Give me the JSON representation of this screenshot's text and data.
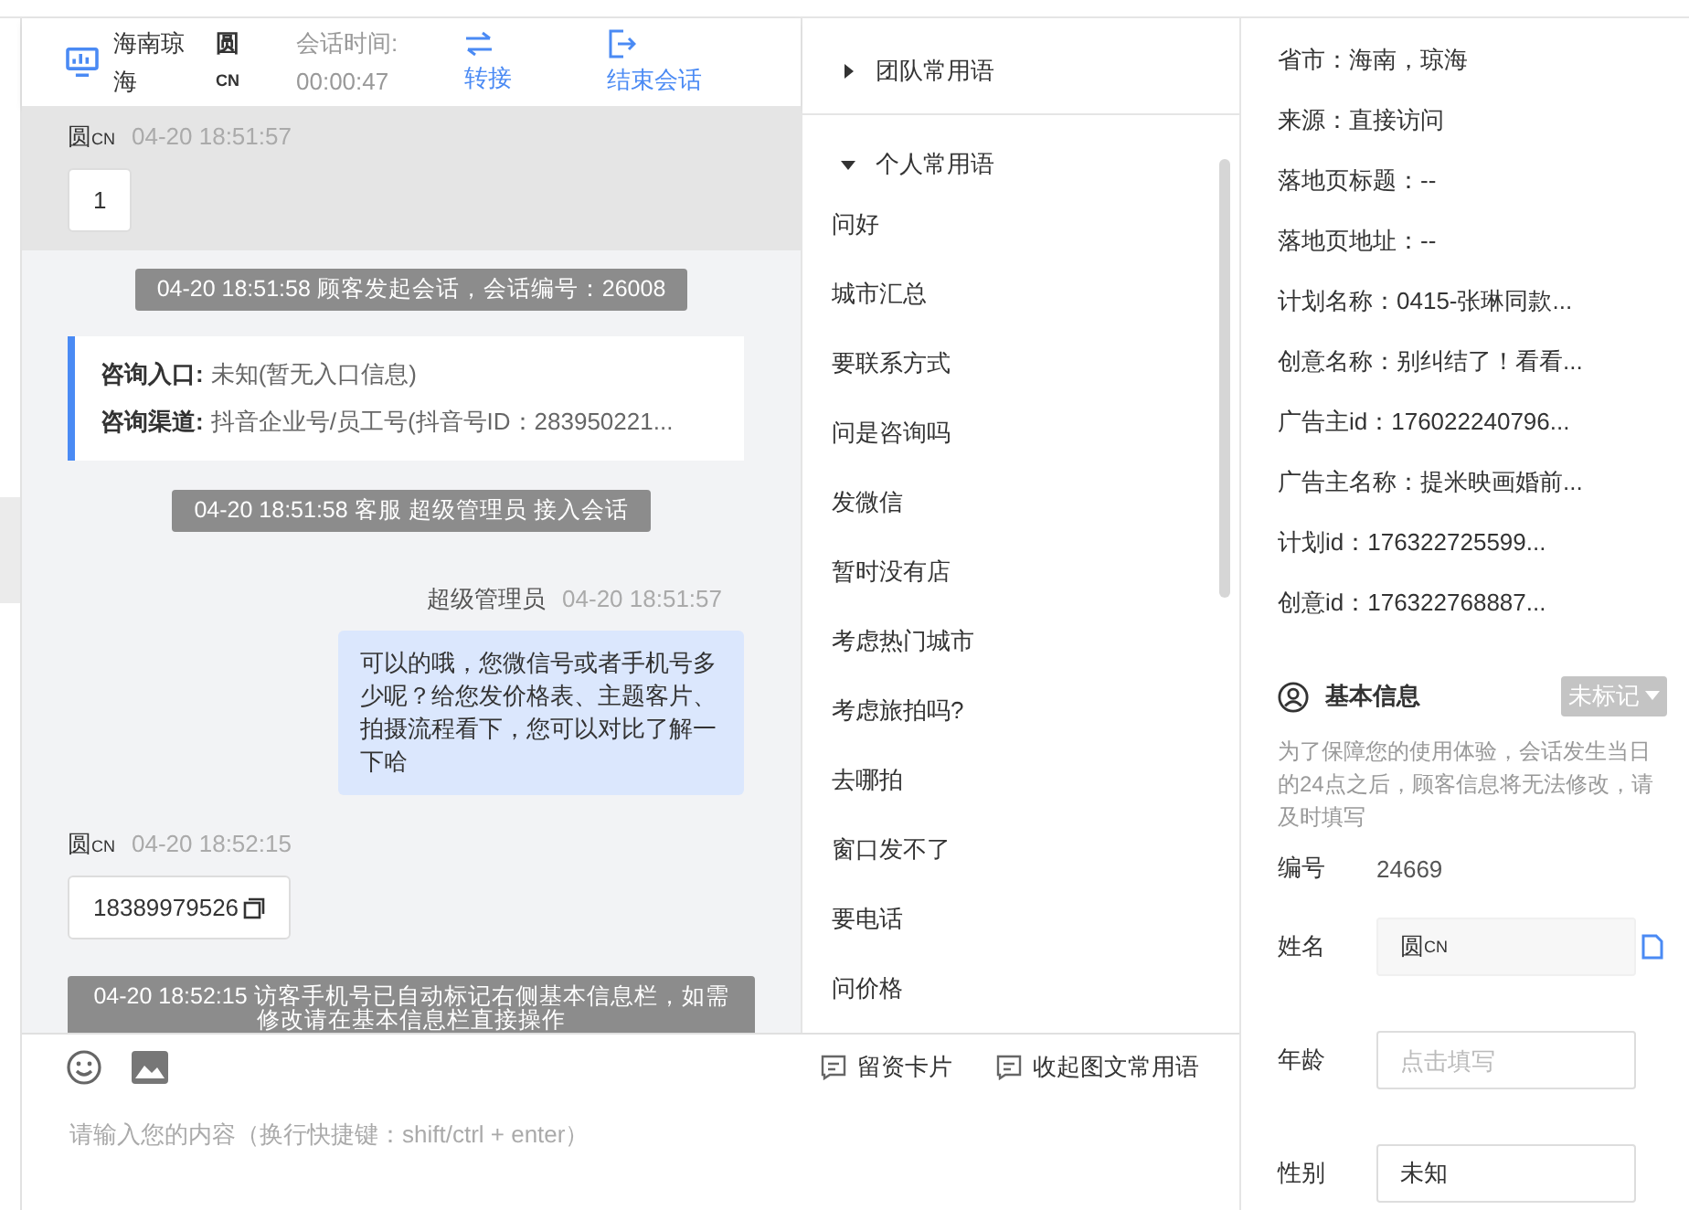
{
  "header": {
    "channel_name": "海南琼海",
    "visitor_name": "圆",
    "visitor_suffix": "CN",
    "session_time_label": "会话时间:",
    "session_time": "00:00:47",
    "actions": [
      {
        "kind": "transfer",
        "label": "转接"
      },
      {
        "kind": "end",
        "label": "结束会话"
      }
    ]
  },
  "messages": [
    {
      "kind": "visitor",
      "name": "圆",
      "name_suffix": "CN",
      "time": "04-20 18:51:57",
      "text": "1",
      "highlighted": true,
      "copyable": false
    },
    {
      "kind": "system",
      "text": "04-20 18:51:58 顾客发起会话，会话编号：26008"
    },
    {
      "kind": "info",
      "fields": [
        {
          "label": "咨询入口:",
          "value": "未知(暂无入口信息)"
        },
        {
          "label": "咨询渠道:",
          "value": "抖音企业号/员工号(抖音号ID：283950221..."
        }
      ]
    },
    {
      "kind": "system",
      "text": "04-20 18:51:58 客服 超级管理员 接入会话"
    },
    {
      "kind": "agent",
      "name": "超级管理员",
      "time": "04-20 18:51:57",
      "text": "可以的哦，您微信号或者手机号多少呢？给您发价格表、主题客片、拍摄流程看下，您可以对比了解一下哈"
    },
    {
      "kind": "visitor",
      "name": "圆",
      "name_suffix": "CN",
      "time": "04-20 18:52:15",
      "text": "18389979526",
      "highlighted": false,
      "copyable": true
    },
    {
      "kind": "system",
      "text": "04-20 18:52:15 访客手机号已自动标记右侧基本信息栏，如需修改请在基本信息栏直接操作"
    }
  ],
  "phrases": [
    {
      "title": "团队常用语",
      "expanded": false
    },
    {
      "title": "个人常用语",
      "expanded": true,
      "items": [
        "问好",
        "城市汇总",
        "要联系方式",
        "问是咨询吗",
        "发微信",
        "暂时没有店",
        "考虑热门城市",
        "考虑旅拍吗?",
        "去哪拍",
        "窗口发不了",
        "要电话",
        "问价格"
      ]
    }
  ],
  "composer": {
    "actions": [
      "留资卡片",
      "收起图文常用语"
    ],
    "placeholder": "请输入您的内容（换行快捷键：shift/ctrl + enter）"
  },
  "visitor_info": [
    "省市：海南，琼海",
    "来源：直接访问",
    "落地页标题：--",
    "落地页地址：--",
    "计划名称：0415-张琳同款...",
    "创意名称：别纠结了！看看...",
    "广告主id：176022240796...",
    "广告主名称：提米映画婚前...",
    "计划id：176322725599...",
    "创意id：176322768887..."
  ],
  "basic_info": {
    "title": "基本信息",
    "tag": "未标记",
    "notice": "为了保障您的使用体验，会话发生当日的24点之后，顾客信息将无法修改，请及时填写",
    "fields": [
      {
        "kind": "text",
        "label": "编号",
        "value": "24669"
      },
      {
        "kind": "readonly",
        "label": "姓名",
        "value": "圆",
        "value_suffix": "CN"
      },
      {
        "kind": "input",
        "label": "年龄",
        "placeholder": "点击填写"
      },
      {
        "kind": "select",
        "label": "性别",
        "value": "未知"
      }
    ]
  }
}
